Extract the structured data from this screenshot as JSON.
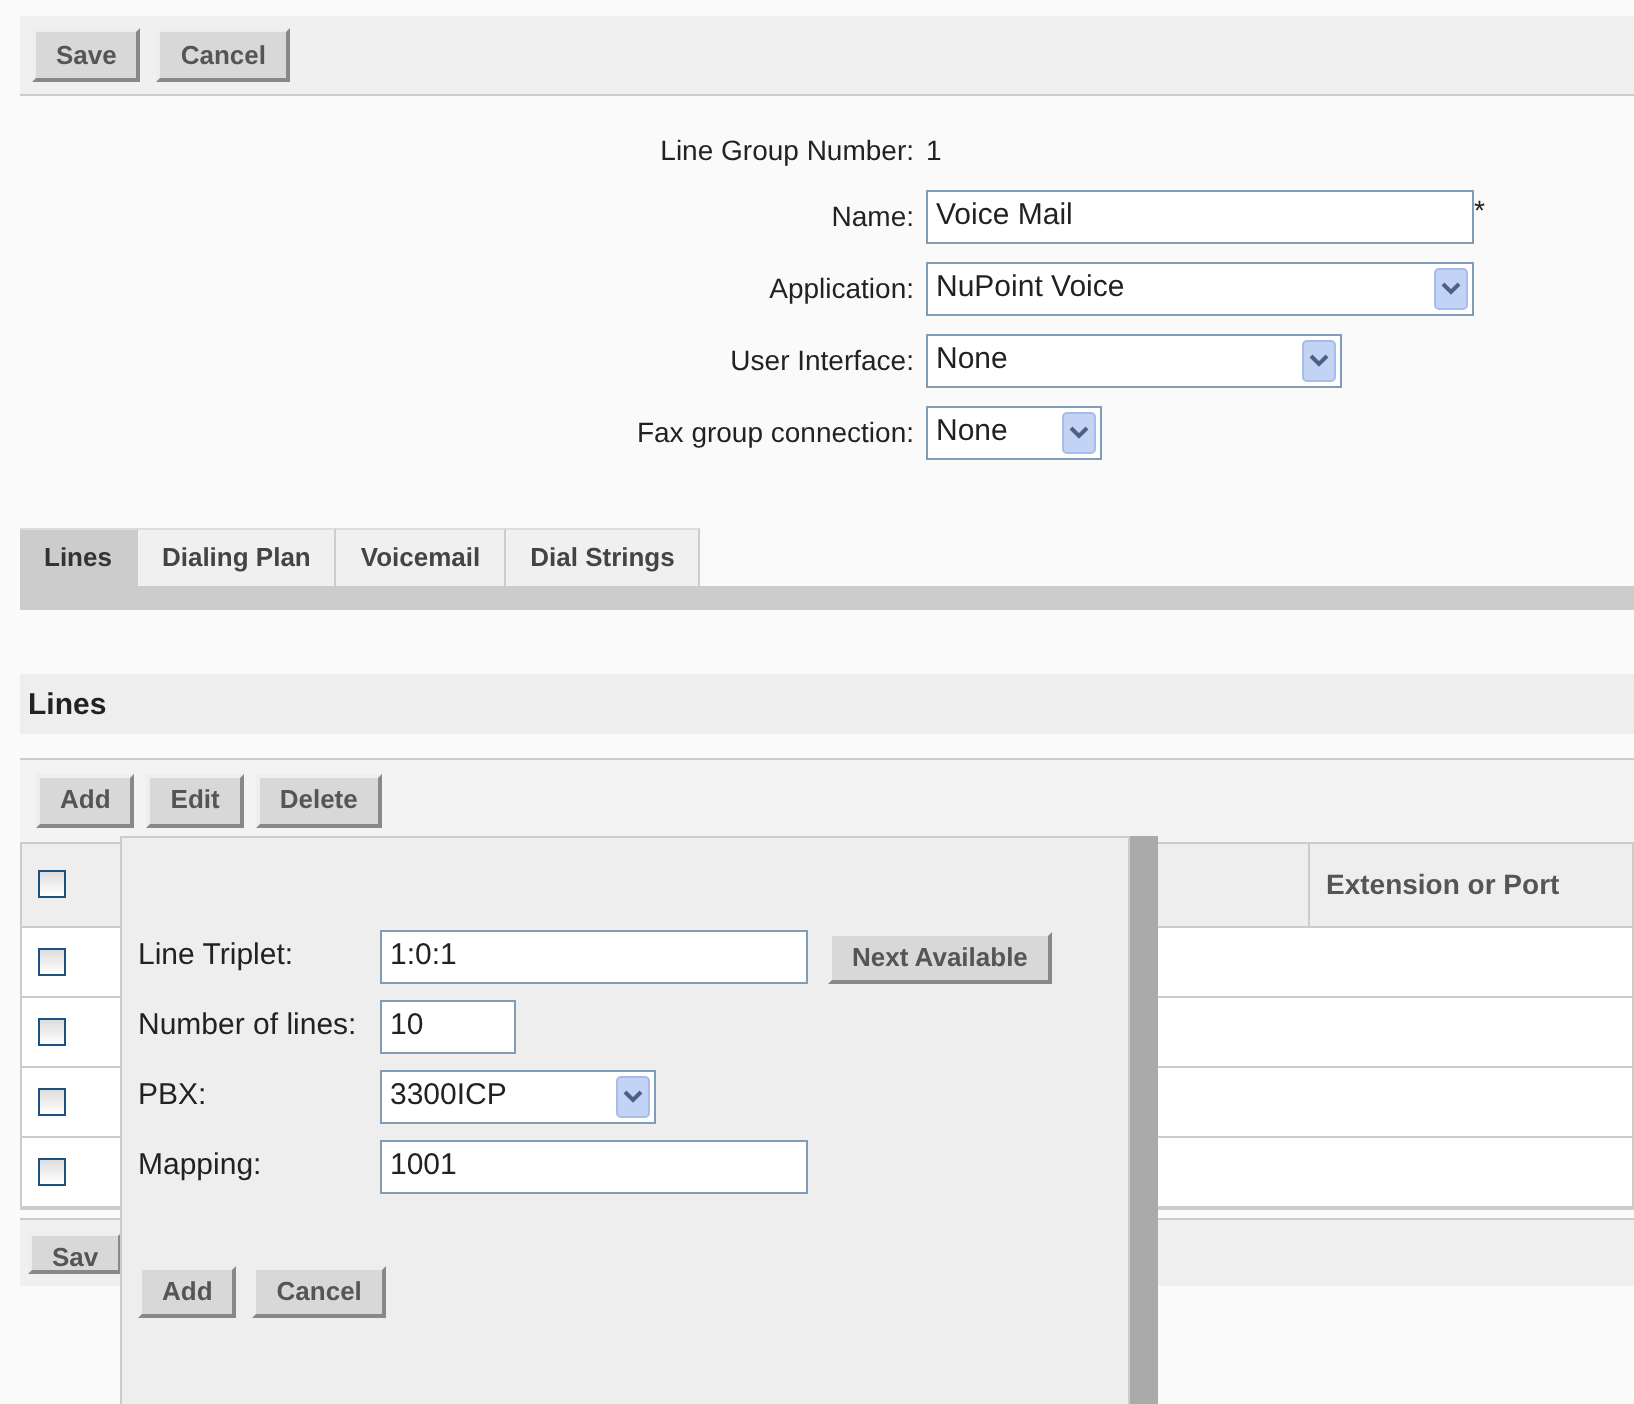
{
  "toolbar": {
    "buttons": [
      "Save",
      "Cancel"
    ]
  },
  "form": {
    "group_number": {
      "label": "Line Group Number:",
      "value": "1"
    },
    "fields": [
      {
        "kind": "text",
        "label": "Name:",
        "value": "Voice Mail",
        "required_mark": "*"
      },
      {
        "kind": "select",
        "label": "Application:",
        "value": "NuPoint Voice"
      },
      {
        "kind": "select",
        "label": "User Interface:",
        "value": "None"
      },
      {
        "kind": "select",
        "label": "Fax group connection:",
        "value": "None"
      }
    ]
  },
  "tabs": [
    {
      "label": "Lines",
      "selected": true
    },
    {
      "label": "Dialing Plan",
      "selected": false
    },
    {
      "label": "Voicemail",
      "selected": false
    },
    {
      "label": "Dial Strings",
      "selected": false
    }
  ],
  "lines_panel": {
    "title": "Lines",
    "buttons": [
      "Add",
      "Edit",
      "Delete"
    ],
    "table": {
      "columns": [
        "Extension or Port"
      ],
      "header_checked": false,
      "rows": [
        {
          "checked": false
        },
        {
          "checked": false
        },
        {
          "checked": false
        },
        {
          "checked": false
        }
      ]
    },
    "bottom_buttons": [
      "Sav"
    ]
  },
  "dialog": {
    "fields": [
      {
        "kind": "text",
        "label": "Line Triplet:",
        "value": "1:0:1",
        "button": "Next Available"
      },
      {
        "kind": "short",
        "label": "Number of lines:",
        "value": "10"
      },
      {
        "kind": "select",
        "label": "PBX:",
        "value": "3300ICP"
      },
      {
        "kind": "text",
        "label": "Mapping:",
        "value": "1001"
      }
    ],
    "buttons": [
      "Add",
      "Cancel"
    ]
  }
}
